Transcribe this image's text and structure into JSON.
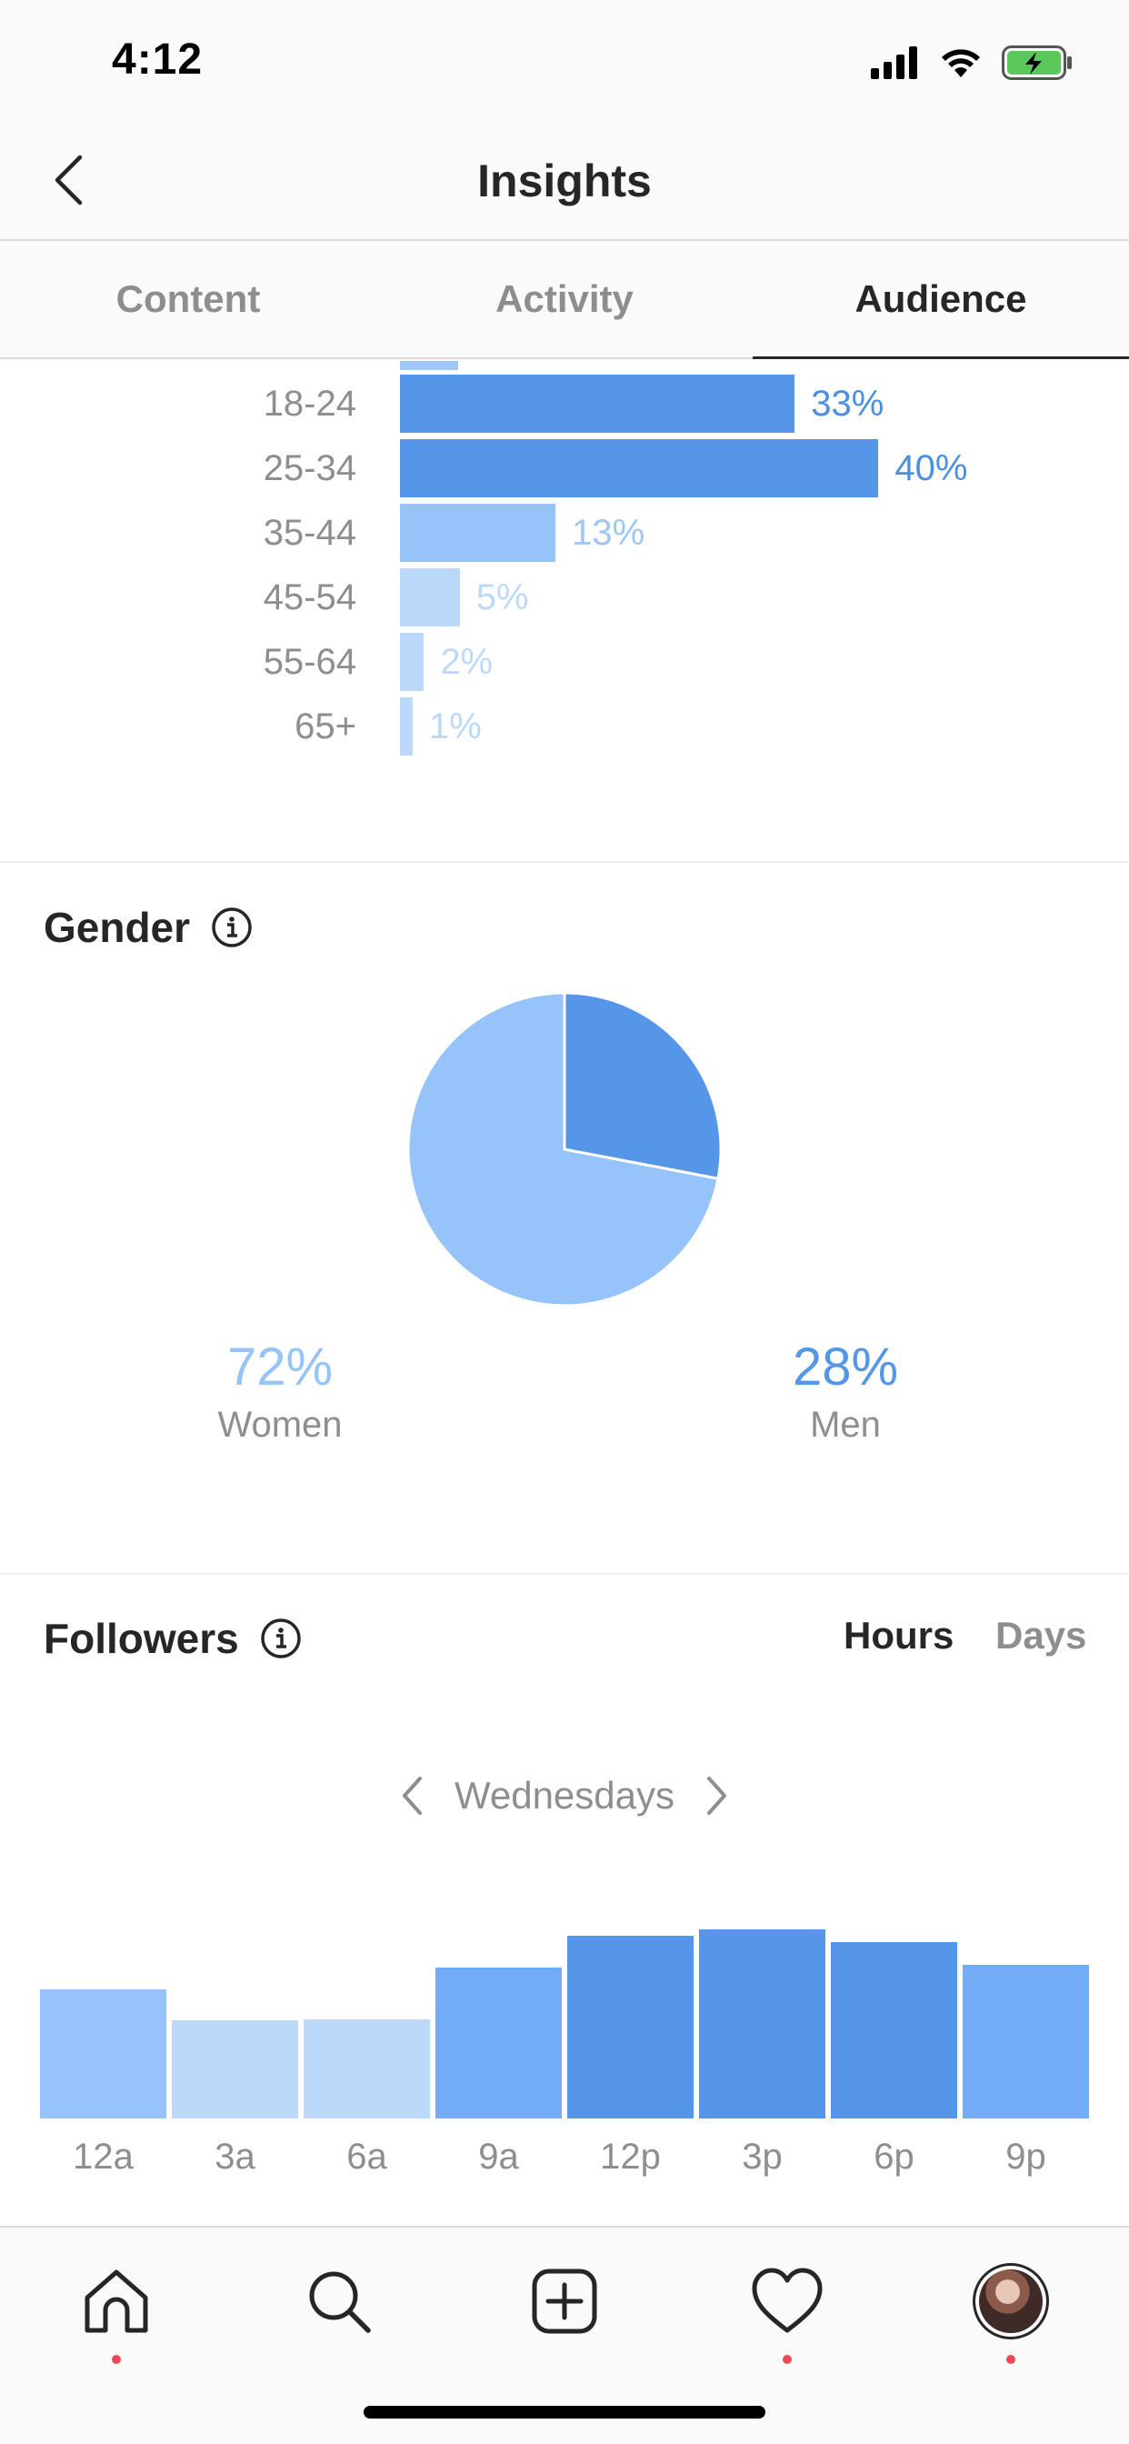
{
  "status_bar": {
    "time": "4:12"
  },
  "header": {
    "title": "Insights"
  },
  "tabs": [
    {
      "label": "Content",
      "active": false
    },
    {
      "label": "Activity",
      "active": false
    },
    {
      "label": "Audience",
      "active": true
    }
  ],
  "age_range": {
    "rows": [
      {
        "label": "18-24",
        "value": 33,
        "pct_label": "33%",
        "color": "#5596e9",
        "text_color": "#4a90e2"
      },
      {
        "label": "25-34",
        "value": 40,
        "pct_label": "40%",
        "color": "#5596e9",
        "text_color": "#4a90e2"
      },
      {
        "label": "35-44",
        "value": 13,
        "pct_label": "13%",
        "color": "#96c3fa",
        "text_color": "#9ec7f7"
      },
      {
        "label": "45-54",
        "value": 5,
        "pct_label": "5%",
        "color": "#bcd9fc",
        "text_color": "#bcd9fb"
      },
      {
        "label": "55-64",
        "value": 2,
        "pct_label": "2%",
        "color": "#bcd9fc",
        "text_color": "#bcd9fb"
      },
      {
        "label": "65+",
        "value": 1,
        "pct_label": "1%",
        "color": "#bcd9fc",
        "text_color": "#bcd9fb"
      }
    ]
  },
  "gender": {
    "title": "Gender",
    "women": {
      "pct": "72%",
      "label": "Women",
      "value": 72,
      "color": "#96c3fa"
    },
    "men": {
      "pct": "28%",
      "label": "Men",
      "value": 28,
      "color": "#5596e9"
    }
  },
  "followers": {
    "title": "Followers",
    "toggle": {
      "hours": "Hours",
      "days": "Days",
      "selected": "Hours"
    },
    "day_label": "Wednesdays",
    "chart_data": {
      "type": "bar",
      "categories": [
        "12a",
        "3a",
        "6a",
        "9a",
        "12p",
        "3p",
        "6p",
        "9p"
      ],
      "values": [
        0.675,
        0.515,
        0.52,
        0.79,
        0.955,
        0.99,
        0.925,
        0.805
      ],
      "colors": [
        "#96c3fa",
        "#bcd9fc",
        "#bcd9fc",
        "#72acf7",
        "#5596e9",
        "#5596e9",
        "#5596e9",
        "#72acf7"
      ]
    }
  },
  "tab_bar": {
    "items": [
      {
        "name": "home",
        "icon": "home-icon",
        "notification": true
      },
      {
        "name": "search",
        "icon": "search-icon",
        "notification": false
      },
      {
        "name": "new-post",
        "icon": "plus-square-icon",
        "notification": false
      },
      {
        "name": "activity",
        "icon": "heart-icon",
        "notification": true
      },
      {
        "name": "profile",
        "icon": "avatar",
        "notification": true
      }
    ]
  }
}
